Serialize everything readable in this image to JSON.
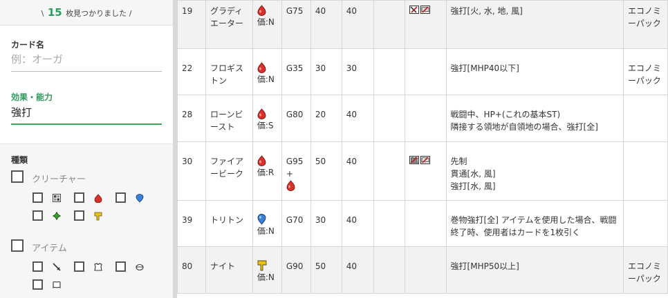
{
  "sidebar": {
    "found_prefix": "\\",
    "found_count": "15",
    "found_text": "枚見つかりました",
    "found_suffix": "/",
    "card_name_label": "カード名",
    "card_name_placeholder": "例：オーガ",
    "card_name_value": "",
    "effect_label": "効果・能力",
    "effect_value": "強打",
    "types_label": "種類",
    "creature_label": "クリーチャー",
    "item_label": "アイテム",
    "creature_filters": [
      "neutral-element-icon",
      "fire-element-icon",
      "water-element-icon",
      "earth-element-icon",
      "wind-element-icon"
    ],
    "item_filters": [
      "weapon-icon",
      "armor-icon",
      "tool-icon",
      "scroll-icon"
    ]
  },
  "table": {
    "rows": [
      {
        "no": "19",
        "name": "グラディエーター",
        "element": "fire",
        "price_label": "価:N",
        "cost": "G75",
        "st": "40",
        "hp": "40",
        "restrict_icons": [
          "no-weapon-icon",
          "no-scroll-icon"
        ],
        "ability": "強打[火, 水, 地, 風]",
        "pack": "エコノミーパック",
        "shade": true
      },
      {
        "no": "22",
        "name": "フロギストン",
        "element": "fire",
        "price_label": "価:N",
        "cost": "G35",
        "st": "30",
        "hp": "30",
        "restrict_icons": [],
        "ability": "強打[MHP40以下]",
        "pack": "エコノミーパック",
        "shade": false
      },
      {
        "no": "28",
        "name": "ローンビースト",
        "element": "fire",
        "price_label": "価:S",
        "cost": "G80",
        "st": "20",
        "hp": "40",
        "restrict_icons": [],
        "ability": "戦闘中、HP+(これの基本ST)\n隣接する領地が自領地の場合、強打[全]",
        "pack": "",
        "shade": false
      },
      {
        "no": "30",
        "name": "ファイアービーク",
        "element": "fire",
        "price_label": "価:R",
        "cost": "G95 +",
        "st": "50",
        "hp": "40",
        "restrict_icons": [
          "no-armor-icon",
          "no-scroll-icon"
        ],
        "ability": "先制\n貫通[水, 風]\n強打[水, 風]",
        "pack": "",
        "shade": false
      },
      {
        "no": "39",
        "name": "トリトン",
        "element": "water",
        "price_label": "価:N",
        "cost": "G70",
        "st": "30",
        "hp": "40",
        "restrict_icons": [],
        "ability": "巻物強打[全] アイテムを使用した場合、戦闘終了時、使用者はカードを1枚引く",
        "pack": "",
        "shade": false
      },
      {
        "no": "80",
        "name": "ナイト",
        "element": "wind",
        "price_label": "価:N",
        "cost": "G90",
        "st": "50",
        "hp": "40",
        "restrict_icons": [],
        "ability": "強打[MHP50以上]",
        "pack": "エコノミーパック",
        "shade": true
      }
    ]
  },
  "colors": {
    "accent": "#2e9b5c",
    "fire": "#d9322b",
    "water": "#3a7fd6",
    "earth": "#3a9b2e",
    "wind": "#e8c21a"
  }
}
